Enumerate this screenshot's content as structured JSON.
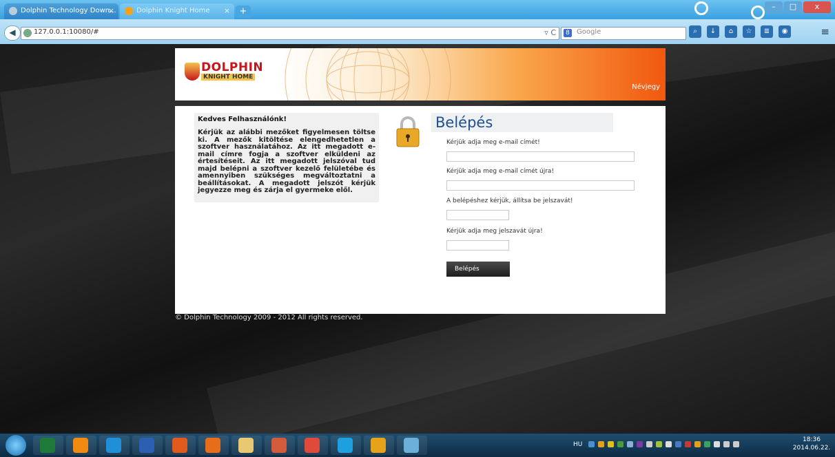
{
  "browser": {
    "tabs": [
      {
        "title": "Dolphin Technology Down...",
        "active": false
      },
      {
        "title": "Dolphin Knight Home",
        "active": true
      }
    ],
    "new_tab_label": "+",
    "url": "127.0.0.1:10080/#",
    "search_placeholder": "Google",
    "window_buttons": {
      "minimize": "–",
      "maximize": "□",
      "close": "x"
    }
  },
  "header": {
    "logo_line1": "DOLPHIN",
    "logo_line2": "KNIGHT HOME",
    "nav_link": "Névjegy"
  },
  "intro": {
    "title": "Kedves Felhasználónk!",
    "text": "Kérjük az alábbi mezőket figyelmesen töltse ki. A mezők kitöltése elengedhetetlen a szoftver használatához. Az itt megadott e-mail címre fogja a szoftver elküldeni az értesítéseit. Az itt megadott jelszóval tud majd belépni a szoftver kezelő felületébe és amennyiben szükséges megváltoztatni a beállításokat. A megadott jelszót kérjük jegyezze meg és zárja el gyermeke elől."
  },
  "login": {
    "title": "Belépés",
    "email_label": "Kérjük adja meg e-mail címét!",
    "email_confirm_label": "Kérjük adja meg e-mail címét újra!",
    "password_label": "A belépéshez kérjük, állítsa be jelszavát!",
    "password_confirm_label": "Kérjük adja meg jelszavát újra!",
    "email_value": "",
    "email_confirm_value": "",
    "password_value": "",
    "password_confirm_value": "",
    "button_label": "Belépés"
  },
  "footer": {
    "copyright": "© Dolphin Technology 2009 - 2012 All rights reserved."
  },
  "taskbar": {
    "language": "HU",
    "time": "18:36",
    "date": "2014.06.22."
  },
  "colors": {
    "login_title": "#1e4f91",
    "header_orange": "#f2580f",
    "button_dark": "#1e1e1e"
  }
}
